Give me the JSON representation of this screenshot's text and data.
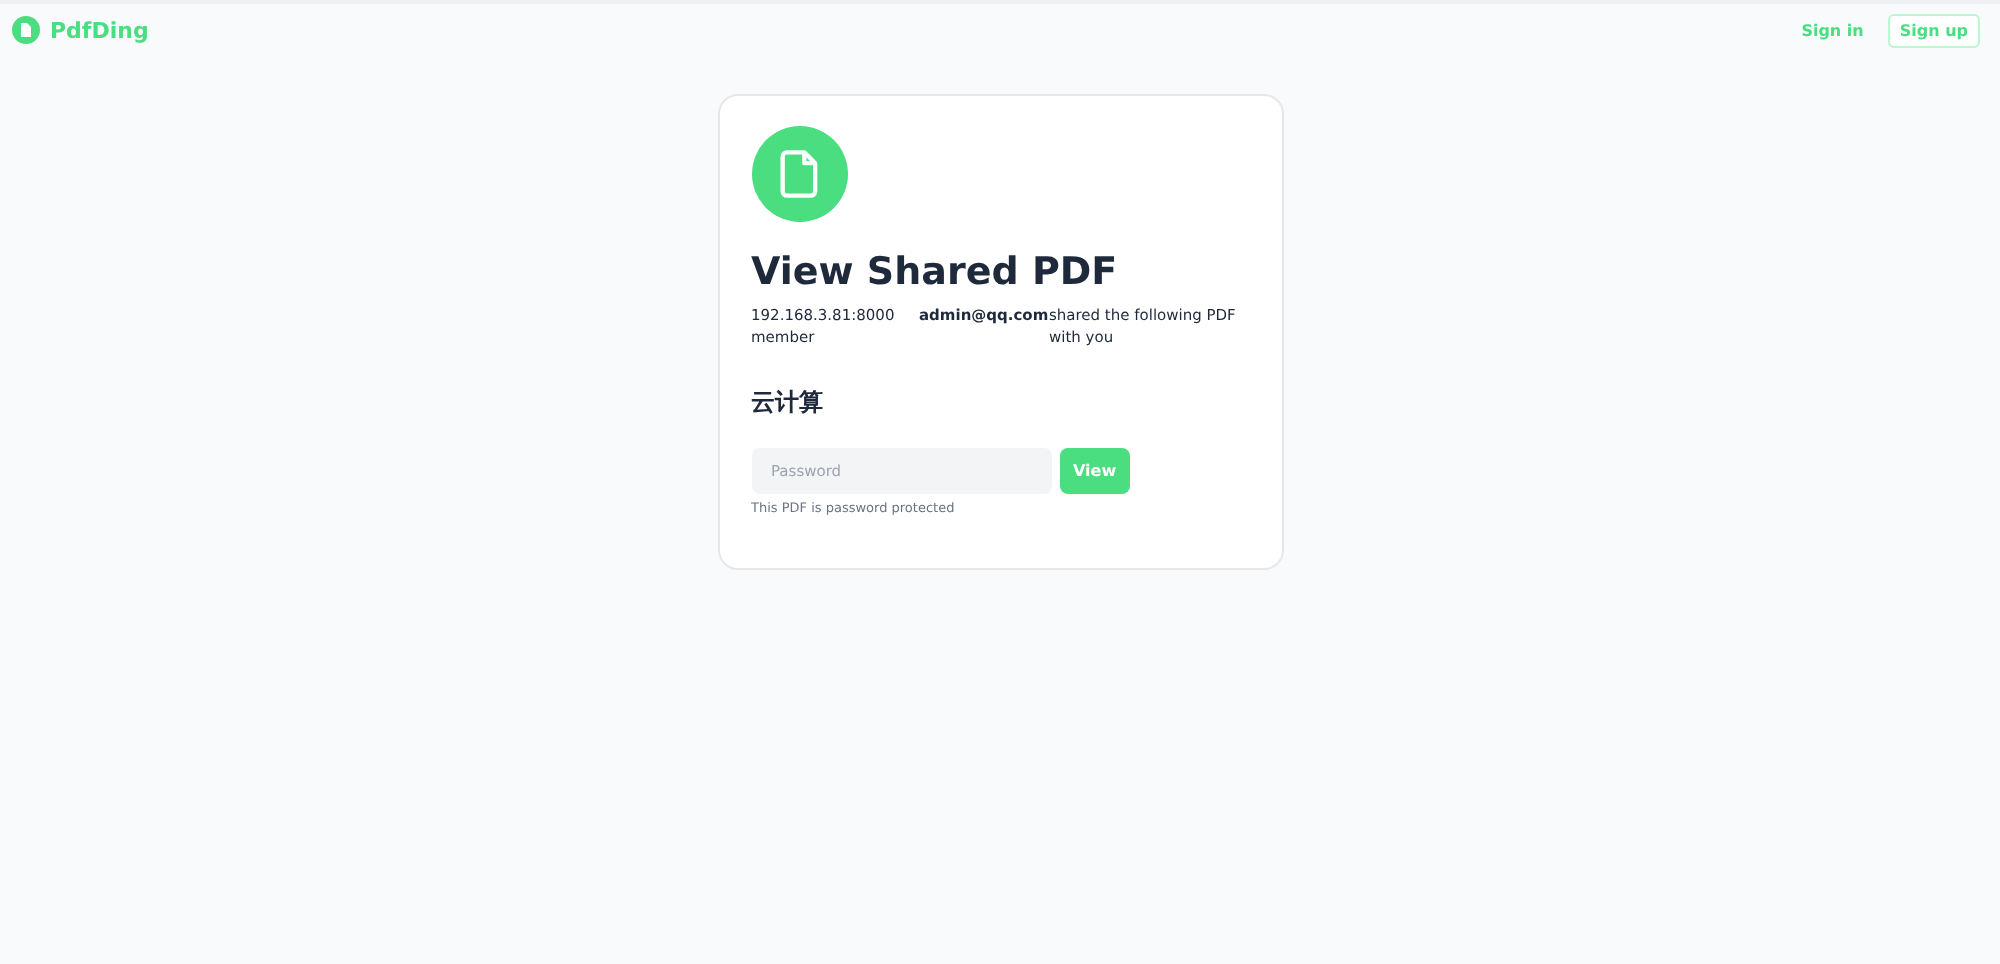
{
  "header": {
    "logo": "PdfDing",
    "sign_in": "Sign in",
    "sign_up": "Sign up"
  },
  "card": {
    "title": "View Shared PDF",
    "sharer": "192.168.3.81:8000 member",
    "email": "admin@qq.com",
    "message": "shared the following PDF with you",
    "pdf_name": "云计算",
    "password": {
      "placeholder": "Password"
    },
    "button": "View",
    "hint": "This PDF is password protected"
  }
}
